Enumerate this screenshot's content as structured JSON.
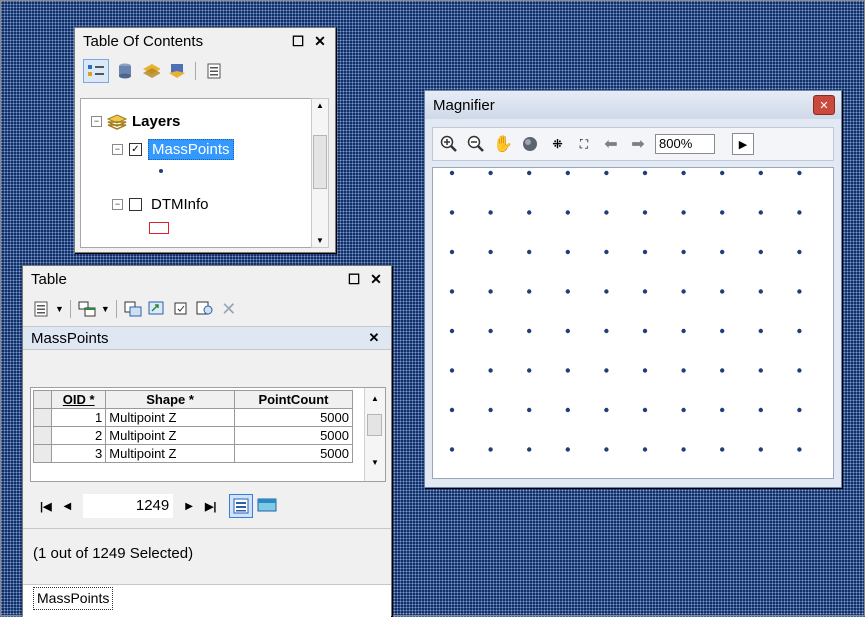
{
  "toc": {
    "title": "Table Of Contents",
    "toolbar_icons": [
      "list-by-drawing-order-icon",
      "list-by-source-icon",
      "list-by-visibility-icon",
      "list-by-selection-icon",
      "options-icon"
    ],
    "root_label": "Layers",
    "layers": [
      {
        "name": "MassPoints",
        "checked": true,
        "selected": true,
        "symbol": "point"
      },
      {
        "name": "DTMInfo",
        "checked": false,
        "selected": false,
        "symbol": "red-outline-rectangle"
      }
    ],
    "checked_mark": "✓"
  },
  "table": {
    "title": "Table",
    "tab_title": "MassPoints",
    "columns": [
      "OID *",
      "Shape *",
      "PointCount"
    ],
    "rows": [
      {
        "oid": "1",
        "shape": "Multipoint Z",
        "count": "5000"
      },
      {
        "oid": "2",
        "shape": "Multipoint Z",
        "count": "5000"
      },
      {
        "oid": "3",
        "shape": "Multipoint Z",
        "count": "5000"
      }
    ],
    "record_value": "1249",
    "status": "(1 out of 1249 Selected)",
    "bottom_tab": "MassPoints"
  },
  "magnifier": {
    "title": "Magnifier",
    "zoom": "800%",
    "toolbar_icons": [
      "zoom-in-icon",
      "zoom-out-icon",
      "pan-icon",
      "full-extent-icon",
      "fixed-zoom-in-icon",
      "fixed-zoom-out-icon",
      "back-icon",
      "forward-icon"
    ],
    "dot_grid": {
      "columns": 10,
      "rows": 8
    }
  },
  "colors": {
    "desktop": "#0b2a63",
    "selection": "#3399ff",
    "point": "#1f3f7a",
    "dtm_symbol": "#e0202a"
  }
}
